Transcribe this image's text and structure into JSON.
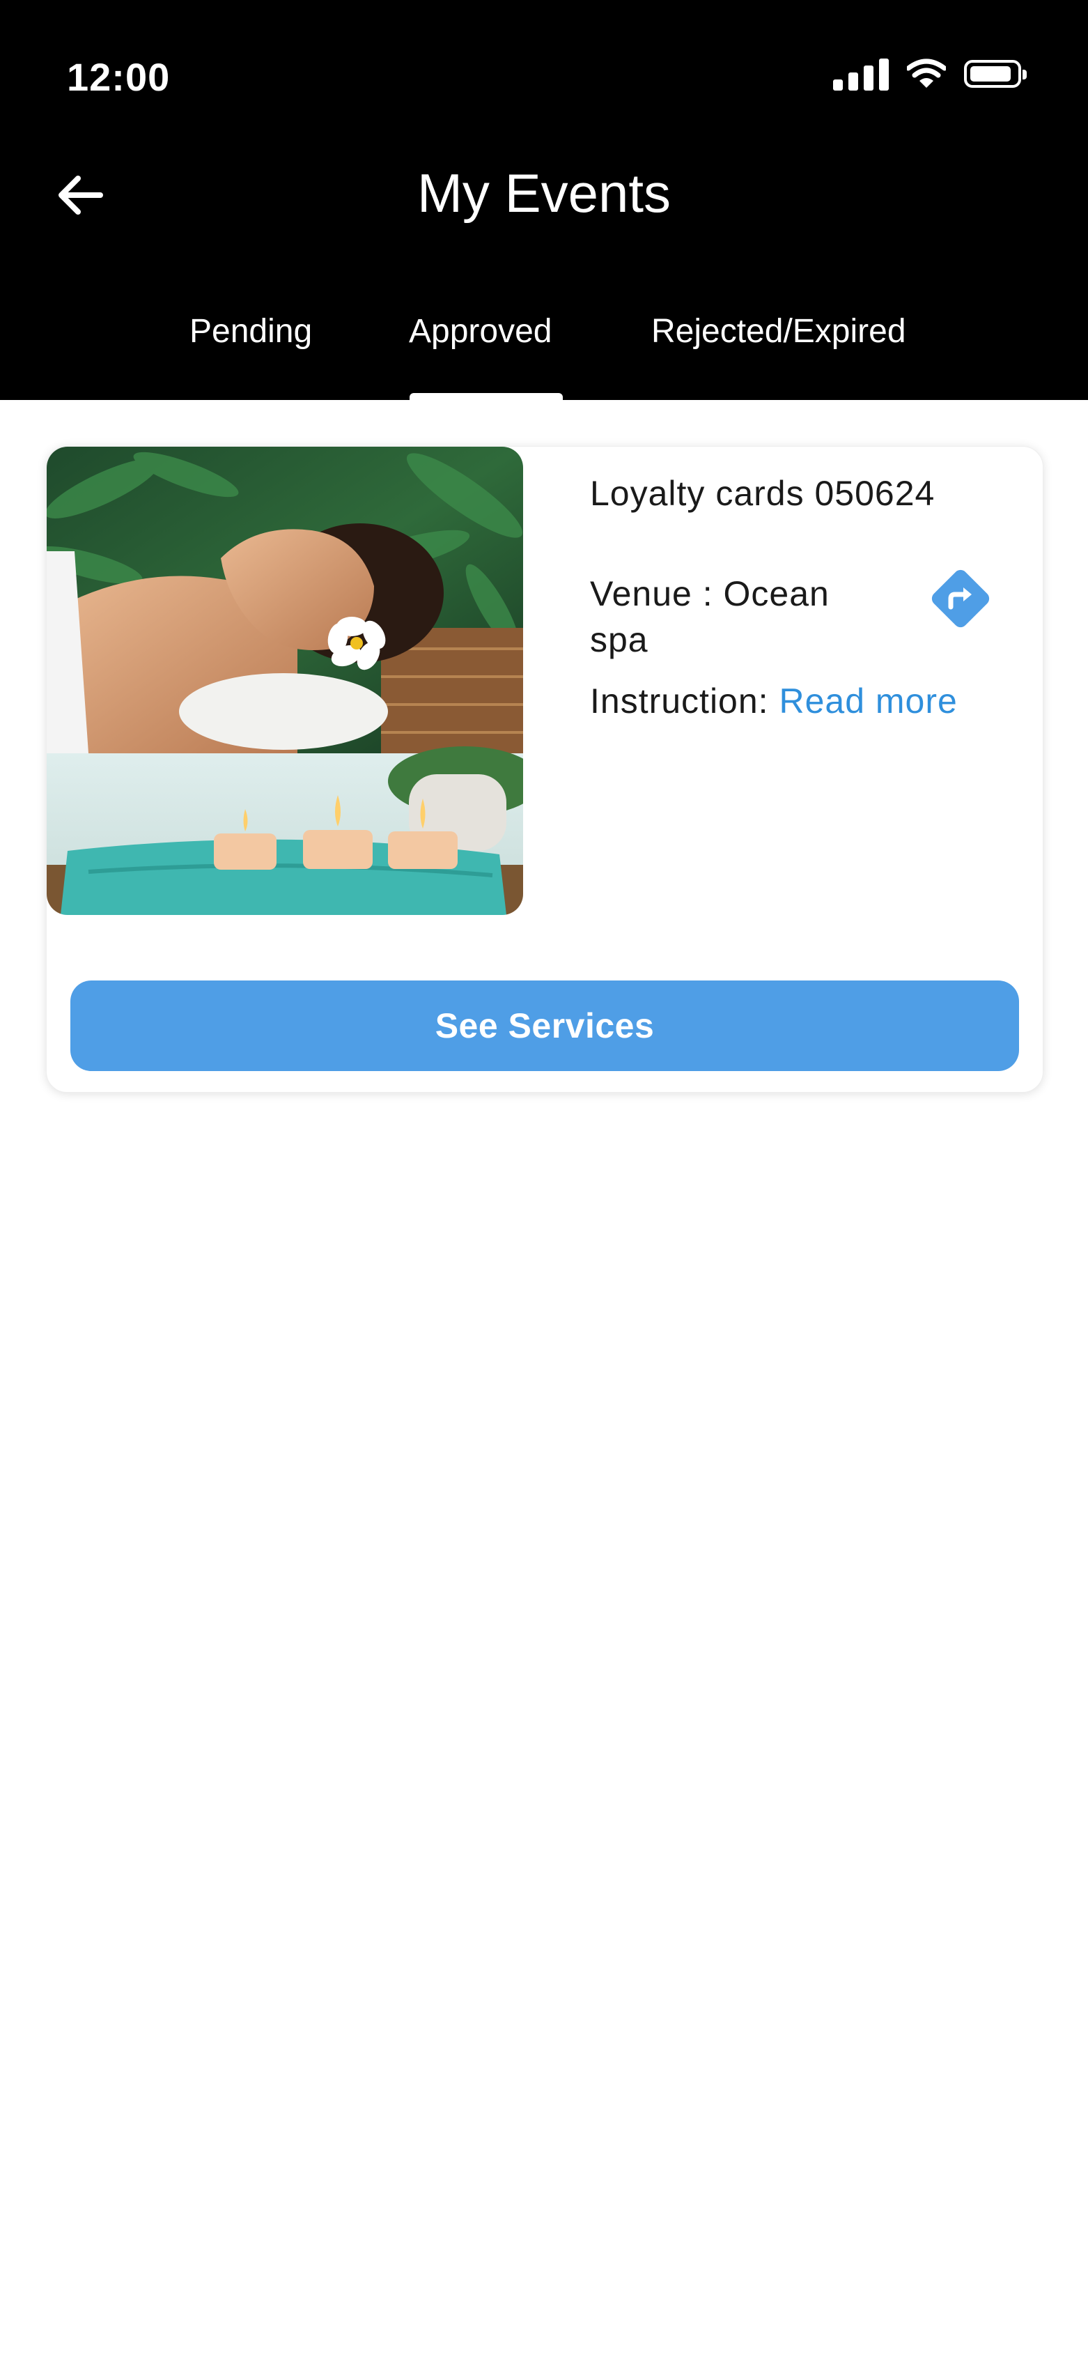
{
  "status_bar": {
    "time": "12:00",
    "icons": [
      "signal-icon",
      "wifi-icon",
      "battery-icon"
    ]
  },
  "header": {
    "title": "My Events",
    "back_icon": "arrow-left-icon"
  },
  "tabs": [
    {
      "label": "Pending",
      "active": false
    },
    {
      "label": "Approved",
      "active": true
    },
    {
      "label": "Rejected/Expired",
      "active": false
    }
  ],
  "event_card": {
    "title": "Loyalty cards 050624",
    "venue": "Venue : Ocean spa",
    "instruction_label": "Instruction:",
    "read_more": "Read more",
    "directions_icon": "directions-icon",
    "image": "spa-photo",
    "button_label": "See Services"
  },
  "colors": {
    "header_bg": "#000000",
    "accent": "#4f9ee6",
    "link": "#2f8fdc",
    "text": "#1a1a1a"
  }
}
